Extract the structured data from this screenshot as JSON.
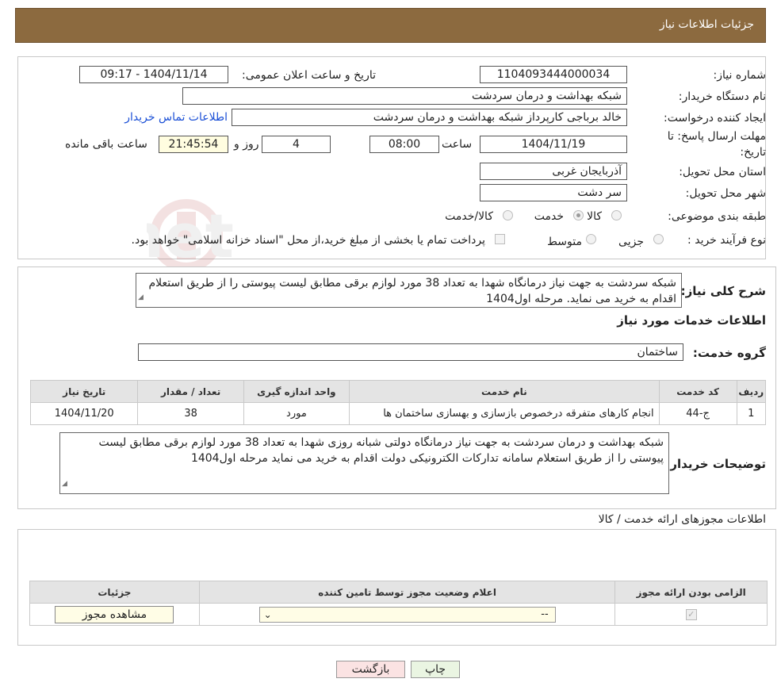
{
  "header": {
    "title": "جزئیات اطلاعات نیاز"
  },
  "info": {
    "need_number_label": "شماره نیاز:",
    "need_number": "1104093444000034",
    "announce_label": "تاریخ و ساعت اعلان عمومی:",
    "announce_value": "1404/11/14 - 09:17",
    "buyer_org_label": "نام دستگاه خریدار:",
    "buyer_org": "شبکه بهداشت و درمان سردشت",
    "requester_label": "ایجاد کننده درخواست:",
    "requester": "خالد برباجی کارپرداز شبکه بهداشت و درمان سردشت",
    "contact_link": "اطلاعات تماس خریدار",
    "deadline_label_1": "مهلت ارسال پاسخ: تا",
    "deadline_label_2": "تاریخ:",
    "deadline_date": "1404/11/19",
    "time_label": "ساعت",
    "deadline_time": "08:00",
    "days_value": "4",
    "days_label": "روز و",
    "remaining_time": "21:45:54",
    "remaining_label": "ساعت باقی مانده",
    "province_label": "استان محل تحویل:",
    "province": "آذربایجان غربی",
    "city_label": "شهر محل تحویل:",
    "city": "سر دشت",
    "category_label": "طبقه بندی موضوعی:",
    "category_options": [
      "کالا",
      "خدمت",
      "کالا/خدمت"
    ],
    "purchase_type_label": "نوع فرآیند خرید :",
    "purchase_options": [
      "جزیی",
      "متوسط"
    ],
    "purchase_note": "پرداخت تمام یا بخشی از مبلغ خرید،از محل \"اسناد خزانه اسلامی\" خواهد بود."
  },
  "summary": {
    "label": "شرح کلی نیاز:",
    "text": "شبکه سردشت به جهت نیاز  درمانگاه  شهدا  به تعداد 38 مورد لوازم برقی مطابق لیست پیوستی  را از طریق استعلام  اقدام به خرید می نماید. مرحله اول1404",
    "services_title": "اطلاعات خدمات مورد نیاز",
    "service_group_label": "گروه خدمت:",
    "service_group": "ساختمان"
  },
  "services_table": {
    "headers": [
      "ردیف",
      "کد خدمت",
      "نام خدمت",
      "واحد اندازه گیری",
      "تعداد / مقدار",
      "تاریخ نیاز"
    ],
    "rows": [
      [
        "1",
        "ج-44",
        "انجام کارهای متفرقه درخصوص بازسازی و بهسازی ساختمان ها",
        "مورد",
        "38",
        "1404/11/20"
      ]
    ]
  },
  "buyer_notes": {
    "label": "توضیحات خریدار:",
    "text": "شبکه بهداشت و درمان سردشت به جهت نیاز  درمانگاه دولتی شبانه روزی شهدا  به تعداد 38 مورد لوازم برقی مطابق لیست پیوستی  را از طریق استعلام سامانه تدارکات الکترونیکی دولت اقدام به خرید می نماید مرحله اول1404"
  },
  "permits": {
    "title": "اطلاعات مجوزهای ارائه خدمت / کالا",
    "headers": [
      "الزامی بودن ارائه مجوز",
      "اعلام وضعیت مجوز توسط تامین کننده",
      "جزئیات"
    ],
    "select_value": "--",
    "view_button": "مشاهده مجوز"
  },
  "footer": {
    "print_button": "چاپ",
    "back_button": "بازگشت"
  },
  "colors": {
    "header_bg": "#8c6a3f",
    "link": "#1a4fd6",
    "back_button_bg": "#fbe3e3",
    "print_button_bg": "#eaf5e2"
  }
}
